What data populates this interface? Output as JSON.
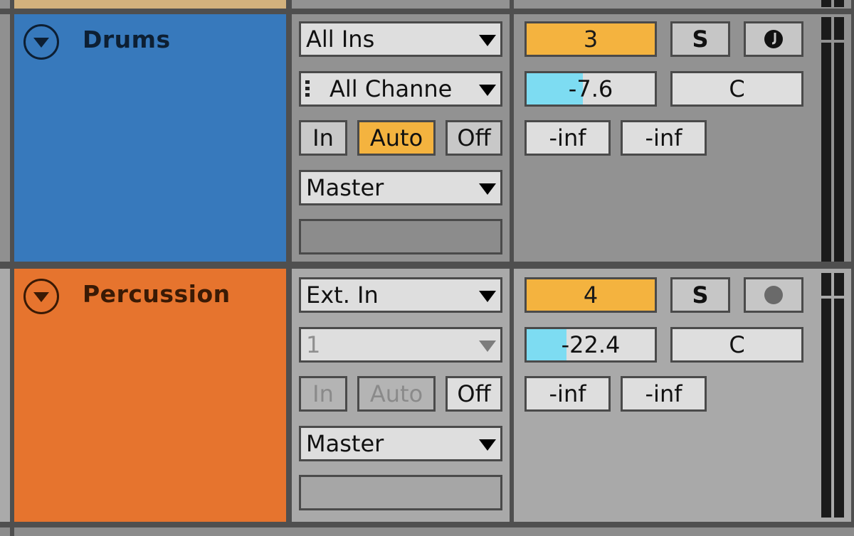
{
  "colors": {
    "drums": "#3779bc",
    "percussion": "#e6742e",
    "top_track": "#d2b17d",
    "active_orange": "#f4b33f",
    "volume_fill": "#7ddcf2"
  },
  "tracks": [
    {
      "name": "Drums",
      "fold_icon": "fold-triangle-icon",
      "input_type": "All Ins",
      "input_channel": "All Channe",
      "input_channel_icon": "channel-selector-icon",
      "monitor": {
        "in": "In",
        "auto": "Auto",
        "off": "Off",
        "active": "auto"
      },
      "output": "Master",
      "track_number": "3",
      "solo": "S",
      "arm_icon": "midi-arm-icon",
      "volume": "-7.6",
      "volume_fill_fraction": 0.44,
      "pan": "C",
      "peak_left": "-inf",
      "peak_right": "-inf"
    },
    {
      "name": "Percussion",
      "fold_icon": "fold-triangle-icon",
      "input_type": "Ext. In",
      "input_channel": "1",
      "monitor": {
        "in": "In",
        "auto": "Auto",
        "off": "Off",
        "active": "off"
      },
      "output": "Master",
      "track_number": "4",
      "solo": "S",
      "arm_icon": "audio-arm-icon",
      "volume": "-22.4",
      "volume_fill_fraction": 0.31,
      "pan": "C",
      "peak_left": "-inf",
      "peak_right": "-inf"
    }
  ]
}
